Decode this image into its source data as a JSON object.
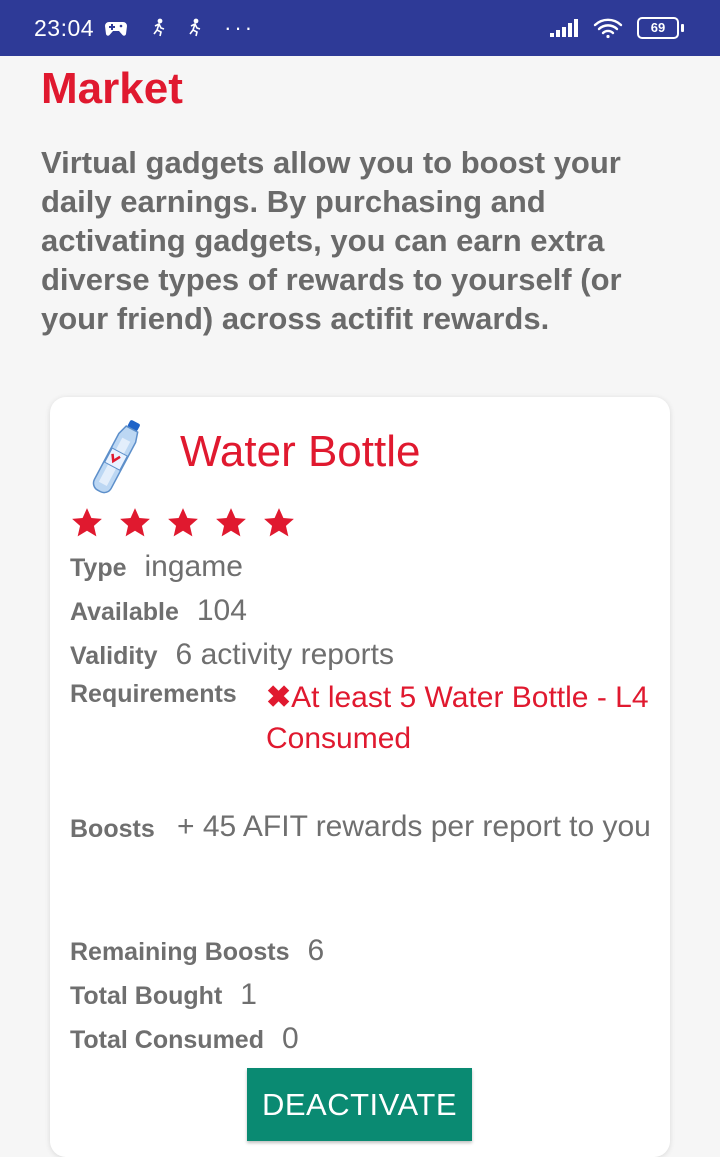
{
  "status_bar": {
    "time": "23:04",
    "icons": [
      "gamepad-icon",
      "running-icon",
      "running-icon",
      "more-icon",
      "signal-icon",
      "wifi-icon",
      "battery-icon"
    ],
    "battery_level": "69",
    "more": "···"
  },
  "page": {
    "title": "Market",
    "intro": "Virtual gadgets allow you to boost your daily earnings. By purchasing and activating gadgets, you can earn extra diverse types of rewards to yourself (or your friend) across actifit rewards."
  },
  "item": {
    "name": "Water Bottle",
    "image_icon": "water-bottle-icon",
    "stars": 5,
    "type_label": "Type",
    "type_value": "ingame",
    "available_label": "Available",
    "available_value": "104",
    "validity_label": "Validity",
    "validity_value": "6 activity reports",
    "requirements_label": "Requirements",
    "requirements_mark": "✖",
    "requirements_value": "At least 5 Water Bottle - L4 Consumed",
    "boosts_label": "Boosts",
    "boosts_value": "+ 45 AFIT rewards per report to you",
    "remaining_label": "Remaining Boosts",
    "remaining_value": "6",
    "bought_label": "Total Bought",
    "bought_value": "1",
    "consumed_label": "Total Consumed",
    "consumed_value": "0",
    "button_label": "DEACTIVATE"
  },
  "colors": {
    "status_bar": "#2e3a97",
    "accent_red": "#e0192f",
    "button": "#0a8a72",
    "text_gray": "#6f6f6f"
  }
}
